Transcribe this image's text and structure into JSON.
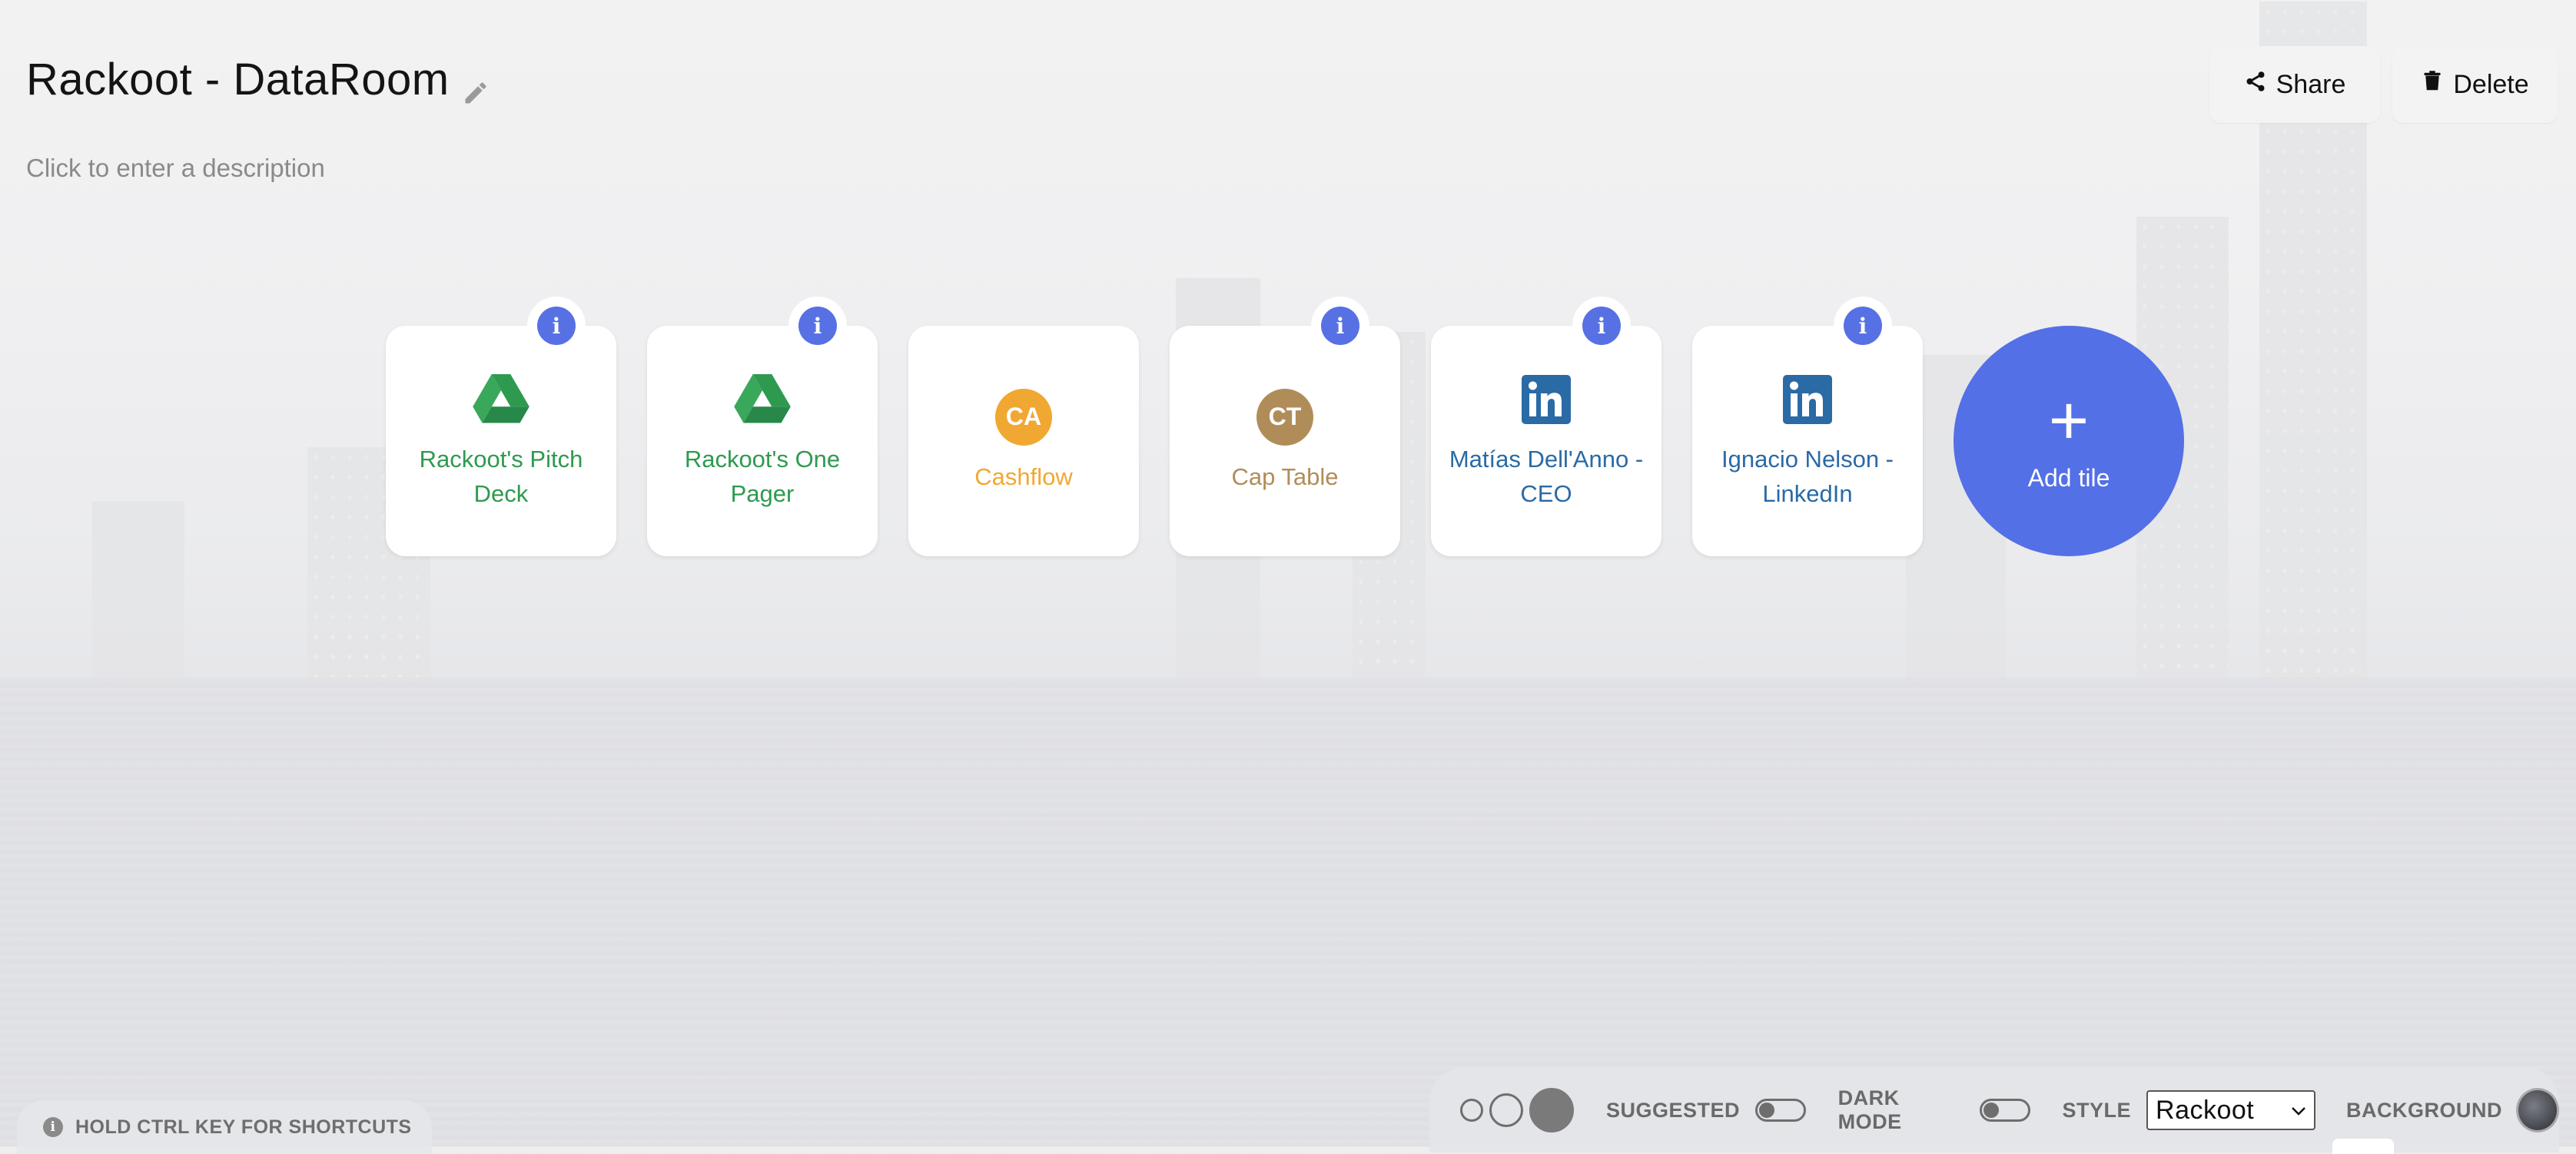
{
  "header": {
    "title": "Rackoot - DataRoom",
    "description_placeholder": "Click to enter a description",
    "share_label": "Share",
    "delete_label": "Delete"
  },
  "tiles": [
    {
      "label": "Rackoot's Pitch Deck",
      "icon": "google-drive-icon",
      "color": "#2e9a4f",
      "has_info": true
    },
    {
      "label": "Rackoot's One Pager",
      "icon": "google-drive-icon",
      "color": "#2e9a4f",
      "has_info": true
    },
    {
      "label": "Cashflow",
      "icon_text": "CA",
      "icon": "initials-avatar",
      "color": "#f0a832",
      "has_info": false
    },
    {
      "label": "Cap Table",
      "icon_text": "CT",
      "icon": "initials-avatar",
      "color": "#b08d58",
      "has_info": true
    },
    {
      "label": "Matías Dell'Anno - CEO",
      "icon": "linkedin-icon",
      "color": "#2a6aa5",
      "has_info": true
    },
    {
      "label": "Ignacio Nelson - LinkedIn",
      "icon": "linkedin-icon",
      "color": "#2a6aa5",
      "has_info": true
    }
  ],
  "add_tile": {
    "label": "Add tile",
    "plus": "+"
  },
  "info_glyph": "i",
  "shortcuts_hint": "HOLD CTRL KEY FOR SHORTCUTS",
  "toolbar": {
    "suggested_label": "SUGGESTED",
    "dark_mode_label": "DARK MODE",
    "style_label": "STYLE",
    "style_value": "Rackoot",
    "background_label": "BACKGROUND"
  },
  "colors": {
    "accent": "#5470e6",
    "title": "#141414",
    "muted": "#8a8a8a"
  }
}
